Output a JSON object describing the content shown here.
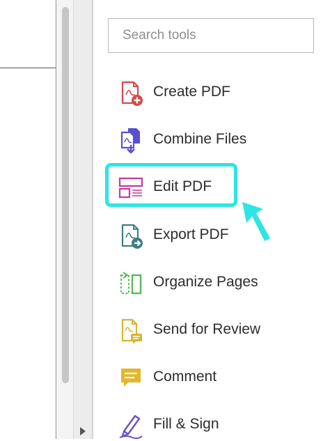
{
  "search": {
    "placeholder": "Search tools"
  },
  "tools": [
    {
      "label": "Create PDF",
      "icon": "create-pdf-icon",
      "color": "#d34a4a"
    },
    {
      "label": "Combine Files",
      "icon": "combine-files-icon",
      "color": "#5a4fcf"
    },
    {
      "label": "Edit PDF",
      "icon": "edit-pdf-icon",
      "color": "#c23a9b"
    },
    {
      "label": "Export PDF",
      "icon": "export-pdf-icon",
      "color": "#3e7f86"
    },
    {
      "label": "Organize Pages",
      "icon": "organize-pages-icon",
      "color": "#5cb85c"
    },
    {
      "label": "Send for Review",
      "icon": "send-for-review-icon",
      "color": "#d8b433"
    },
    {
      "label": "Comment",
      "icon": "comment-icon",
      "color": "#e1b72e"
    },
    {
      "label": "Fill & Sign",
      "icon": "fill-sign-icon",
      "color": "#6b4fc8"
    }
  ],
  "highlight_color": "#2de5e5"
}
